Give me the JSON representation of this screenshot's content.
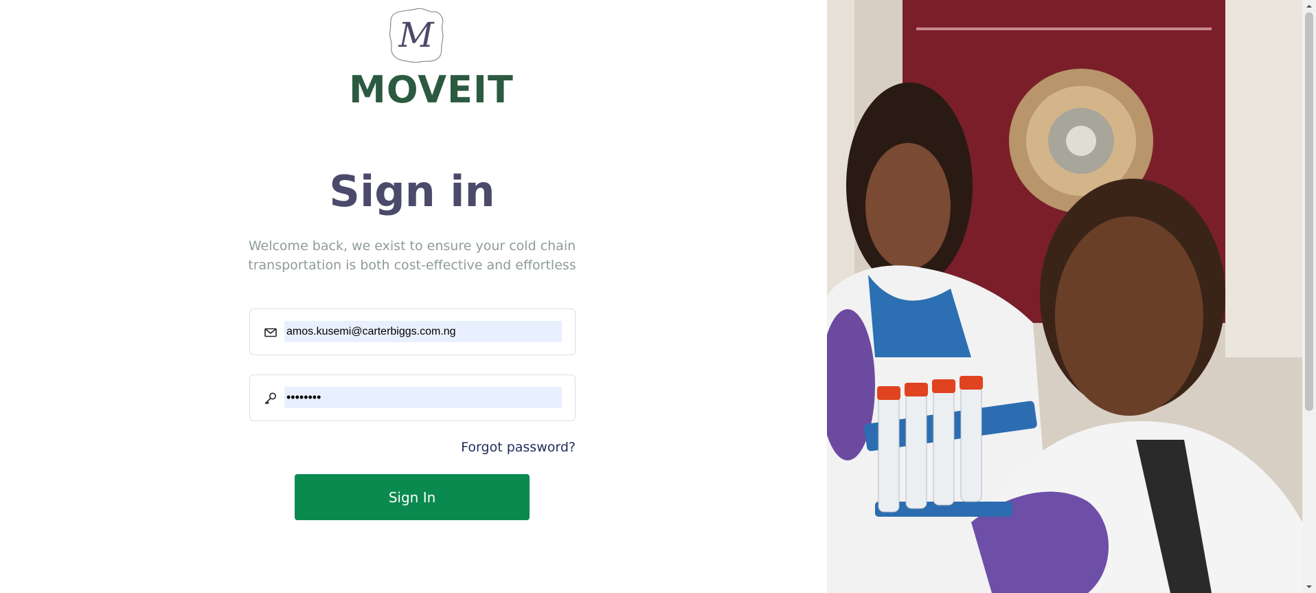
{
  "brand": {
    "badge_letter": "M",
    "wordmark": "MOVEIT",
    "wordmark_color": "#2c5a40"
  },
  "page": {
    "title": "Sign in",
    "subtitle_line1": "Welcome back, we exist to ensure your cold chain",
    "subtitle_line2": "transportation is both cost-effective and effortless"
  },
  "form": {
    "email": {
      "icon": "mail-icon",
      "value": "amos.kusemi@carterbiggs.com.ng"
    },
    "password": {
      "icon": "key-icon",
      "masked_value": "••••••••"
    },
    "forgot_label": "Forgot password?",
    "submit_label": "Sign In",
    "submit_color": "#0b8a50"
  },
  "hero_image": {
    "subject": "two lab technicians in white coats examining sample tubes in a blue rack"
  }
}
